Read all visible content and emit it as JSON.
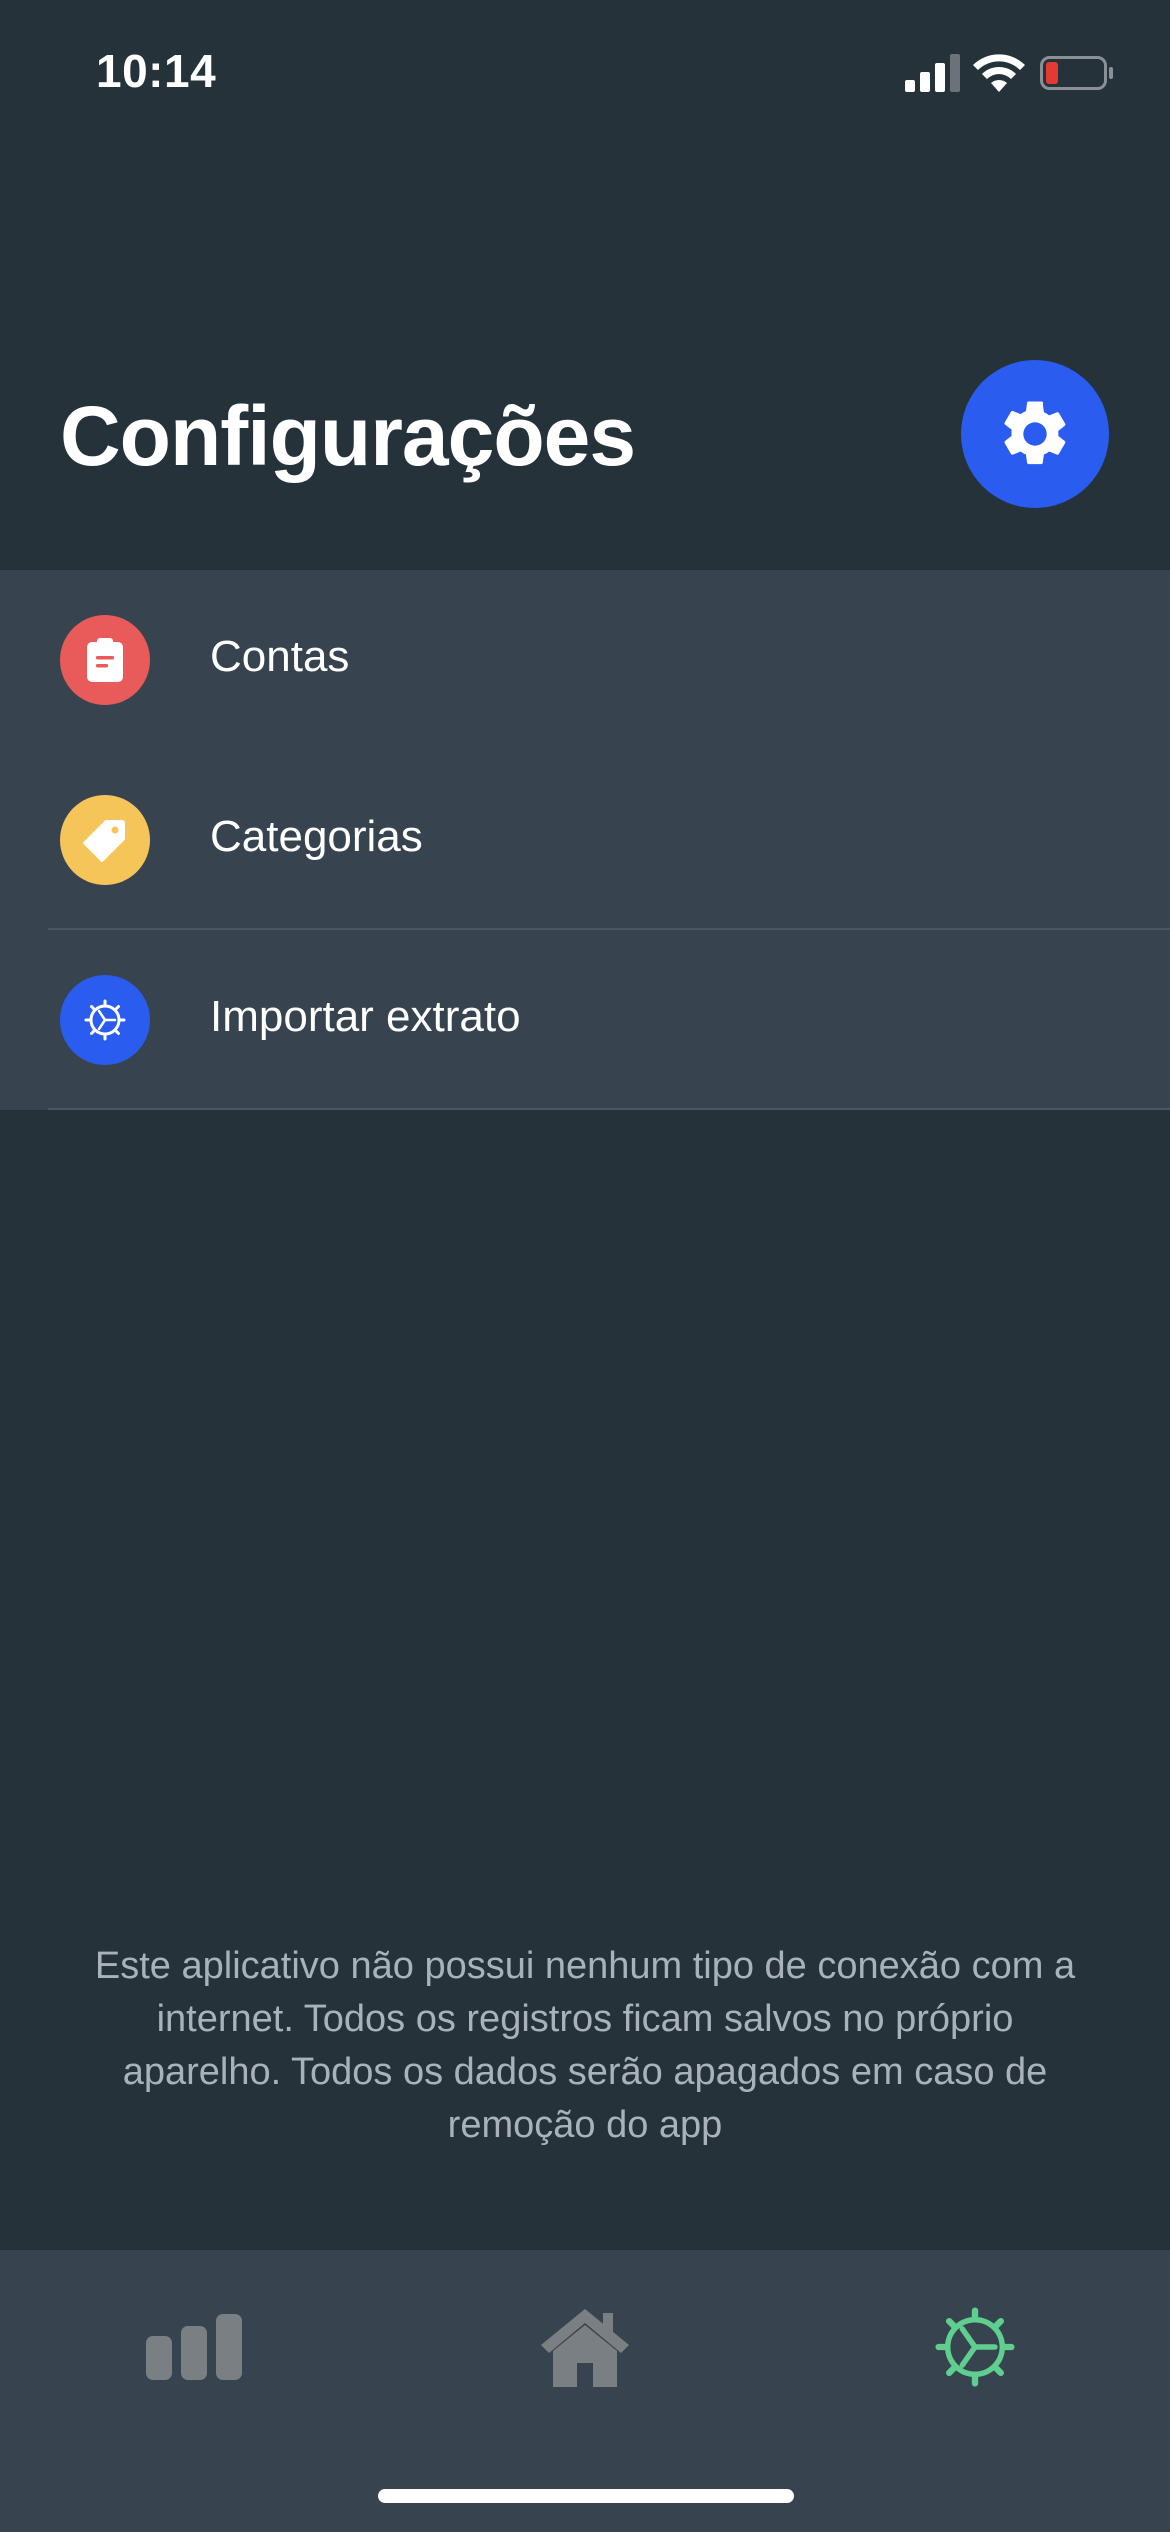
{
  "status_bar": {
    "time": "10:14",
    "icons": [
      "cellular-signal-icon",
      "wifi-icon",
      "battery-low-icon"
    ]
  },
  "header": {
    "title": "Configurações",
    "action_icon": "gear-icon",
    "action_color": "#2b5cf0"
  },
  "settings": {
    "items": [
      {
        "label": "Contas",
        "icon": "clipboard-icon",
        "color": "#e95b5b"
      },
      {
        "label": "Categorias",
        "icon": "tag-icon",
        "color": "#f5c55a"
      },
      {
        "label": "Importar extrato",
        "icon": "import-gear-icon",
        "color": "#2b5cf0"
      }
    ]
  },
  "footer": {
    "note": "Este aplicativo não possui nenhum tipo de conexão com a internet. Todos os registros ficam salvos no próprio aparelho. Todos os dados serão apagados em caso de remoção do app"
  },
  "tab_bar": {
    "tabs": [
      {
        "icon": "bar-chart-icon",
        "active": false
      },
      {
        "icon": "home-icon",
        "active": false
      },
      {
        "icon": "settings-gear-icon",
        "active": true
      }
    ],
    "active_color": "#5fcf8f",
    "inactive_color": "#7a7f84"
  },
  "colors": {
    "background": "#25323a",
    "list_background": "#37444f",
    "battery_low": "#e53935"
  }
}
